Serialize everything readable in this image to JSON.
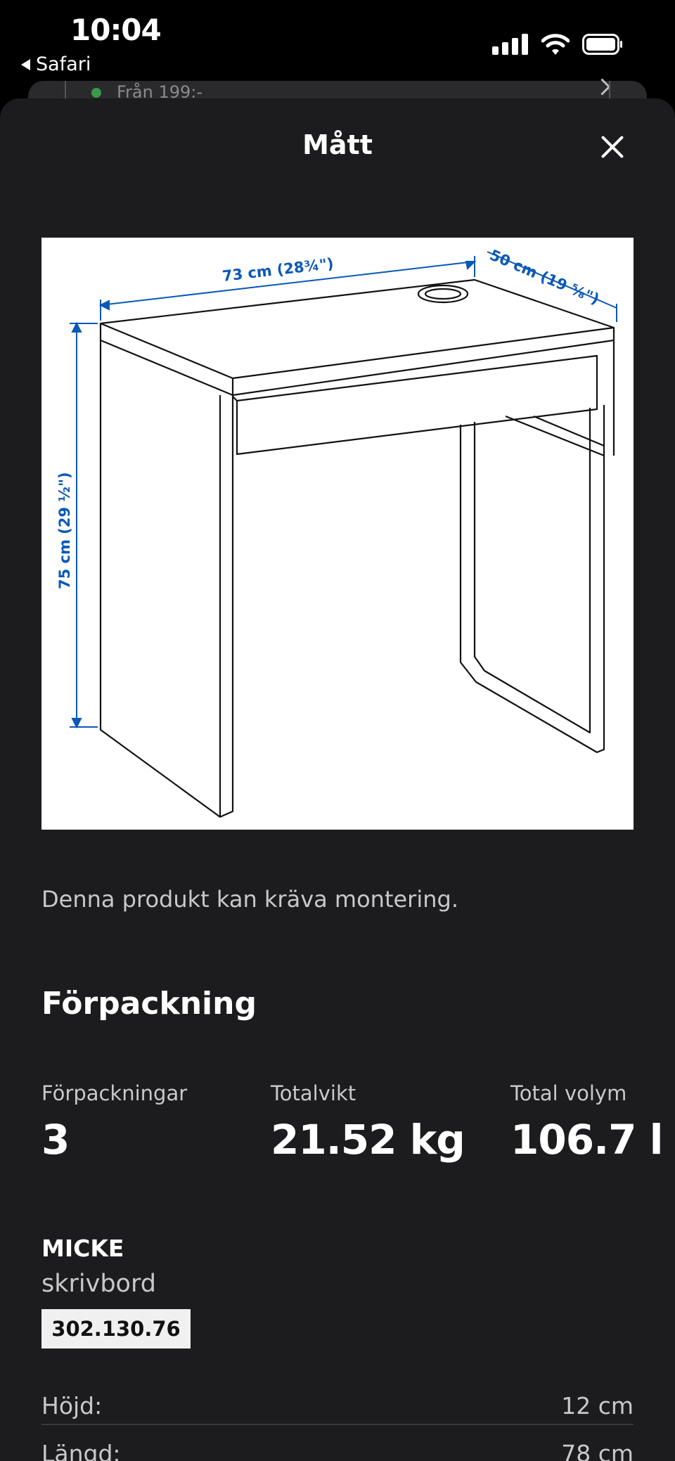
{
  "status_bar": {
    "time": "10:04",
    "back_label": "Safari"
  },
  "background_row": {
    "text": "Från 199:-"
  },
  "sheet": {
    "title": "Mått"
  },
  "diagram": {
    "width_label": "73 cm (28¾\")",
    "depth_label": "50 cm (19 ⅝\")",
    "height_label": "75 cm (29 ½\")",
    "line_color": "#0a58b8"
  },
  "assembly_note": "Denna produkt kan kräva montering.",
  "packaging": {
    "heading": "Förpackning",
    "stats": [
      {
        "label": "Förpackningar",
        "value": "3"
      },
      {
        "label": "Totalvikt",
        "value": "21.52 kg"
      },
      {
        "label": "Total volym",
        "value": "106.7 l"
      }
    ]
  },
  "product": {
    "name": "MICKE",
    "type": "skrivbord",
    "article_number": "302.130.76",
    "specs": [
      {
        "label": "Höjd:",
        "value": "12 cm"
      },
      {
        "label": "Längd:",
        "value": "78 cm"
      }
    ]
  }
}
